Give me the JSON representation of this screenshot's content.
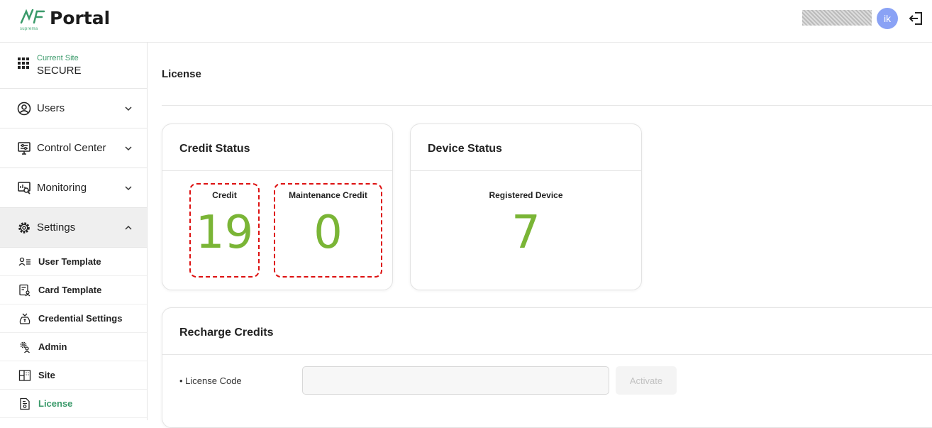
{
  "header": {
    "app_name": "Portal",
    "brand_sub": "suprema",
    "avatar_initials": "ik"
  },
  "sidebar": {
    "site_label": "Current Site",
    "site_name": "SECURE",
    "items": [
      {
        "label": "Users",
        "expanded": false
      },
      {
        "label": "Control Center",
        "expanded": false
      },
      {
        "label": "Monitoring",
        "expanded": false
      },
      {
        "label": "Settings",
        "expanded": true
      }
    ],
    "sub_items": [
      {
        "label": "User Template"
      },
      {
        "label": "Card Template"
      },
      {
        "label": "Credential Settings"
      },
      {
        "label": "Admin"
      },
      {
        "label": "Site"
      },
      {
        "label": "License"
      }
    ]
  },
  "main": {
    "page_title": "License",
    "credit_status": {
      "title": "Credit Status",
      "credit_label": "Credit",
      "credit_value": "19",
      "maintenance_label": "Maintenance Credit",
      "maintenance_value": "0"
    },
    "device_status": {
      "title": "Device Status",
      "registered_label": "Registered Device",
      "registered_value": "7"
    },
    "recharge": {
      "title": "Recharge Credits",
      "license_code_label": "• License Code",
      "license_code_value": "",
      "activate_label": "Activate"
    }
  },
  "colors": {
    "accent_green": "#7ab536",
    "active_text": "#3a9a6a",
    "avatar_bg": "#8aa2f5",
    "highlight_dash": "#dd1111"
  }
}
